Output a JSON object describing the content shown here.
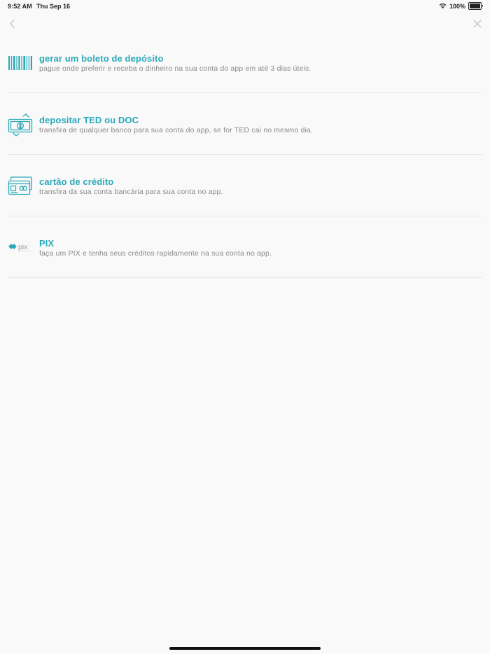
{
  "status_bar": {
    "time": "9:52 AM",
    "date": "Thu Sep 16",
    "battery": "100%",
    "wifi_icon": "wifi-icon",
    "battery_icon": "battery-icon"
  },
  "nav": {
    "back_icon": "chevron-left-icon",
    "close_icon": "close-icon"
  },
  "options": [
    {
      "id": "boleto",
      "icon": "barcode-icon",
      "title": "gerar um boleto de depósito",
      "description": "pague onde preferir e receba o dinheiro na sua conta do app em até 3 dias úteis."
    },
    {
      "id": "ted-doc",
      "icon": "money-transfer-icon",
      "title": "depositar TED ou DOC",
      "description": "transfira de qualquer banco para sua conta do app, se for TED cai no mesmo dia."
    },
    {
      "id": "credit-card",
      "icon": "credit-card-icon",
      "title": "cartão de crédito",
      "description": "transfira da sua conta bancária para sua conta no app."
    },
    {
      "id": "pix",
      "icon": "pix-logo-icon",
      "logo_text": "pix",
      "title": "PIX",
      "description": "faça um PIX e tenha seus créditos rapidamente na sua conta no app."
    }
  ],
  "colors": {
    "accent": "#2aa9b8",
    "description": "#8a8a8a",
    "background": "#f9f9f9",
    "divider": "#e8e8e8"
  }
}
